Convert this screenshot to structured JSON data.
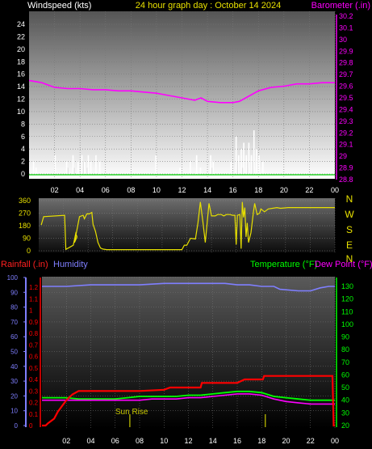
{
  "header": {
    "left": "Windspeed (kts)",
    "center": "24 hour graph day : October 14 2024",
    "right": "Barometer (.in)"
  },
  "colors": {
    "wind": "#ffffff",
    "gust": "#ffffff",
    "barometer": "#ff00ff",
    "direction": "#e8e000",
    "rain": "#ff0000",
    "humidity": "#7f7fff",
    "temperature": "#00ff00",
    "dewpoint": "#ff00ff",
    "green_axis": "#00ff00",
    "blue_axis": "#7f7fff",
    "sun": "#c8c800"
  },
  "chart_data": [
    {
      "type": "bar",
      "panel": "wind",
      "ylabel": "Windspeed (kts)",
      "ylim": [
        0,
        25
      ],
      "y_ticks": [
        "24",
        "22",
        "20",
        "18",
        "16",
        "14",
        "12",
        "10",
        "8",
        "6",
        "4",
        "2",
        "0"
      ],
      "x_ticks": [
        "02",
        "04",
        "06",
        "08",
        "10",
        "12",
        "14",
        "16",
        "18",
        "20",
        "22",
        "00"
      ],
      "xlim": [
        0,
        24
      ],
      "gusts": [
        [
          0.3,
          2
        ],
        [
          0.5,
          1
        ],
        [
          2.0,
          3
        ],
        [
          2.9,
          2
        ],
        [
          3.4,
          3
        ],
        [
          3.8,
          2
        ],
        [
          4.1,
          3
        ],
        [
          4.3,
          2
        ],
        [
          4.6,
          3
        ],
        [
          4.8,
          2
        ],
        [
          5.2,
          3
        ],
        [
          5.5,
          2
        ],
        [
          9.9,
          3
        ],
        [
          11.8,
          1
        ],
        [
          12.6,
          2
        ],
        [
          13.1,
          3
        ],
        [
          13.4,
          1
        ],
        [
          14.2,
          3
        ],
        [
          14.4,
          2
        ],
        [
          15.8,
          2
        ],
        [
          16.2,
          6
        ],
        [
          16.4,
          3
        ],
        [
          16.6,
          4
        ],
        [
          16.8,
          5
        ],
        [
          17.0,
          3
        ],
        [
          17.2,
          5
        ],
        [
          17.4,
          3
        ],
        [
          17.6,
          7
        ],
        [
          17.8,
          4
        ],
        [
          18.0,
          3
        ],
        [
          18.3,
          2
        ]
      ],
      "wind": [
        [
          3.0,
          1
        ],
        [
          3.5,
          1
        ],
        [
          4.2,
          2
        ],
        [
          4.5,
          1
        ],
        [
          14.3,
          1
        ],
        [
          16.3,
          2
        ],
        [
          16.7,
          1
        ],
        [
          17.1,
          2
        ],
        [
          17.5,
          2
        ]
      ]
    },
    {
      "type": "line",
      "panel": "barometer",
      "ylabel": "Barometer (.in)",
      "ylim": [
        28.8,
        30.25
      ],
      "y_ticks": [
        "30.2",
        "30.1",
        "30",
        "29.9",
        "29.8",
        "29.7",
        "29.6",
        "29.5",
        "29.4",
        "29.3",
        "29.2",
        "29.1",
        "29",
        "28.9",
        "28.8"
      ],
      "x": [
        0,
        1,
        2,
        3,
        4,
        5,
        6,
        7,
        8,
        9,
        10,
        11,
        12,
        13,
        13.5,
        14,
        15,
        16,
        16.5,
        17,
        18,
        19,
        20,
        21,
        22,
        23,
        24
      ],
      "values": [
        29.65,
        29.63,
        29.59,
        29.58,
        29.58,
        29.57,
        29.57,
        29.56,
        29.56,
        29.55,
        29.54,
        29.52,
        29.5,
        29.48,
        29.5,
        29.47,
        29.46,
        29.46,
        29.47,
        29.5,
        29.56,
        29.59,
        29.6,
        29.62,
        29.62,
        29.63,
        29.63
      ]
    },
    {
      "type": "line",
      "panel": "direction",
      "y_ticks": [
        "360",
        "270",
        "180",
        "90",
        "0"
      ],
      "compass": [
        "N",
        "W",
        "S",
        "E",
        "N"
      ],
      "ylim": [
        0,
        360
      ],
      "x": [
        0.2,
        0.4,
        2.1,
        2.2,
        2.6,
        2.8,
        3.0,
        3.1,
        2.9,
        3.3,
        3.6,
        3.7,
        3.9,
        4.1,
        4.2,
        4.3,
        4.4,
        4.6,
        4.8,
        5.0,
        5.2,
        5.5,
        5.7,
        11.6,
        11.8,
        12.0,
        12.3,
        12.7,
        12.9,
        13.1,
        13.3,
        13.5,
        13.8,
        14.0,
        14.3,
        14.5,
        14.8,
        15.0,
        15.2,
        15.5,
        15.7,
        15.9,
        16.0,
        16.1,
        16.3,
        16.4,
        16.5,
        16.6,
        16.7,
        16.8,
        16.9,
        17.0,
        17.2,
        17.4,
        17.5,
        17.7,
        17.9,
        18.0,
        18.3,
        18.6,
        19.3,
        19.6,
        20.2,
        20.6,
        24.0
      ],
      "values": [
        185,
        245,
        255,
        10,
        30,
        40,
        125,
        100,
        60,
        245,
        255,
        230,
        265,
        265,
        270,
        275,
        190,
        140,
        60,
        20,
        12,
        8,
        8,
        8,
        40,
        40,
        90,
        85,
        200,
        350,
        210,
        60,
        340,
        250,
        250,
        260,
        260,
        250,
        260,
        260,
        255,
        255,
        45,
        255,
        260,
        15,
        350,
        240,
        310,
        100,
        200,
        60,
        130,
        280,
        340,
        260,
        270,
        300,
        280,
        300,
        310,
        305,
        310,
        310,
        310
      ]
    },
    {
      "type": "line",
      "panel": "environment",
      "header_left_1": "Rainfall (.in)",
      "header_left_2": "Humidity",
      "header_right_1": "Temperature (°F)",
      "header_right_2": "Dew Point (°F)",
      "left_ticks_hum": [
        "100",
        "90",
        "80",
        "70",
        "60",
        "50",
        "40",
        "30",
        "20",
        "10",
        "0"
      ],
      "left_ticks_rain": [
        "1.2",
        "1.1",
        "1",
        "0.9",
        "0.8",
        "0.7",
        "0.6",
        "0.5",
        "0.4",
        "0.3",
        "0.2",
        "0.1",
        "0"
      ],
      "right_ticks": [
        "130",
        "120",
        "110",
        "100",
        "90",
        "80",
        "70",
        "60",
        "50",
        "40",
        "30",
        "20"
      ],
      "x_ticks": [
        "02",
        "04",
        "06",
        "08",
        "10",
        "12",
        "14",
        "16",
        "18",
        "20",
        "22",
        "00"
      ],
      "rain_range": [
        0,
        1.24
      ],
      "temp_range": [
        18,
        136
      ],
      "hum_range": [
        0,
        100
      ],
      "sunrise_label": "Sun Rise",
      "sunrise_x": 7.2,
      "sunset_x": 18.3,
      "humidity": {
        "x": [
          0,
          2,
          4,
          6,
          8,
          10,
          11,
          12,
          14,
          15,
          16,
          17,
          18,
          19,
          19.5,
          21,
          22,
          22.8,
          23.5,
          24
        ],
        "values": [
          94,
          94,
          95,
          95,
          95,
          96,
          96,
          96,
          96,
          96,
          95,
          95,
          94,
          94,
          92,
          91,
          91,
          93,
          94,
          94
        ]
      },
      "rain": {
        "x": [
          0,
          0.3,
          0.5,
          1.0,
          1.3,
          2.0,
          2.5,
          3.0,
          5.0,
          8.0,
          10.0,
          10.5,
          11.0,
          13.0,
          13.1,
          16.0,
          16.6,
          18.1,
          18.2,
          23.8,
          23.9,
          24.0
        ],
        "values": [
          0,
          0,
          0.02,
          0.06,
          0.12,
          0.22,
          0.27,
          0.3,
          0.3,
          0.3,
          0.31,
          0.33,
          0.33,
          0.33,
          0.37,
          0.37,
          0.4,
          0.4,
          0.43,
          0.43,
          0.0,
          0.0
        ]
      },
      "temperature": {
        "x": [
          0,
          1,
          2,
          3,
          4,
          5,
          6,
          7,
          8,
          9,
          10,
          11,
          12,
          13,
          14,
          15,
          16,
          17,
          18,
          19,
          20,
          21,
          22,
          23,
          24
        ],
        "values": [
          42,
          42,
          42,
          41,
          41,
          41,
          41,
          42,
          43,
          43,
          43,
          43,
          44,
          44,
          45,
          46,
          47,
          47,
          46,
          43,
          42,
          41,
          40,
          40,
          40
        ]
      },
      "dewpoint": {
        "x": [
          0,
          1,
          2,
          3,
          4,
          5,
          6,
          7,
          8,
          9,
          10,
          11,
          12,
          13,
          14,
          15,
          16,
          17,
          18,
          19,
          20,
          21,
          22,
          23,
          24
        ],
        "values": [
          40,
          40,
          40,
          40,
          40,
          40,
          40,
          40,
          40,
          41,
          41,
          41,
          42,
          42,
          43,
          44,
          45,
          45,
          44,
          41,
          39,
          38,
          37,
          37,
          37
        ]
      }
    }
  ]
}
